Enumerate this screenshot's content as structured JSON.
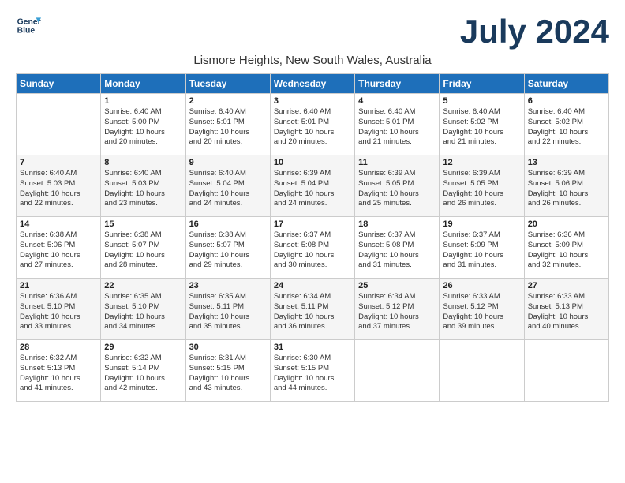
{
  "logo": {
    "line1": "General",
    "line2": "Blue"
  },
  "title": "July 2024",
  "subtitle": "Lismore Heights, New South Wales, Australia",
  "days_of_week": [
    "Sunday",
    "Monday",
    "Tuesday",
    "Wednesday",
    "Thursday",
    "Friday",
    "Saturday"
  ],
  "weeks": [
    [
      {
        "day": "",
        "info": ""
      },
      {
        "day": "1",
        "info": "Sunrise: 6:40 AM\nSunset: 5:00 PM\nDaylight: 10 hours\nand 20 minutes."
      },
      {
        "day": "2",
        "info": "Sunrise: 6:40 AM\nSunset: 5:01 PM\nDaylight: 10 hours\nand 20 minutes."
      },
      {
        "day": "3",
        "info": "Sunrise: 6:40 AM\nSunset: 5:01 PM\nDaylight: 10 hours\nand 20 minutes."
      },
      {
        "day": "4",
        "info": "Sunrise: 6:40 AM\nSunset: 5:01 PM\nDaylight: 10 hours\nand 21 minutes."
      },
      {
        "day": "5",
        "info": "Sunrise: 6:40 AM\nSunset: 5:02 PM\nDaylight: 10 hours\nand 21 minutes."
      },
      {
        "day": "6",
        "info": "Sunrise: 6:40 AM\nSunset: 5:02 PM\nDaylight: 10 hours\nand 22 minutes."
      }
    ],
    [
      {
        "day": "7",
        "info": "Sunrise: 6:40 AM\nSunset: 5:03 PM\nDaylight: 10 hours\nand 22 minutes."
      },
      {
        "day": "8",
        "info": "Sunrise: 6:40 AM\nSunset: 5:03 PM\nDaylight: 10 hours\nand 23 minutes."
      },
      {
        "day": "9",
        "info": "Sunrise: 6:40 AM\nSunset: 5:04 PM\nDaylight: 10 hours\nand 24 minutes."
      },
      {
        "day": "10",
        "info": "Sunrise: 6:39 AM\nSunset: 5:04 PM\nDaylight: 10 hours\nand 24 minutes."
      },
      {
        "day": "11",
        "info": "Sunrise: 6:39 AM\nSunset: 5:05 PM\nDaylight: 10 hours\nand 25 minutes."
      },
      {
        "day": "12",
        "info": "Sunrise: 6:39 AM\nSunset: 5:05 PM\nDaylight: 10 hours\nand 26 minutes."
      },
      {
        "day": "13",
        "info": "Sunrise: 6:39 AM\nSunset: 5:06 PM\nDaylight: 10 hours\nand 26 minutes."
      }
    ],
    [
      {
        "day": "14",
        "info": "Sunrise: 6:38 AM\nSunset: 5:06 PM\nDaylight: 10 hours\nand 27 minutes."
      },
      {
        "day": "15",
        "info": "Sunrise: 6:38 AM\nSunset: 5:07 PM\nDaylight: 10 hours\nand 28 minutes."
      },
      {
        "day": "16",
        "info": "Sunrise: 6:38 AM\nSunset: 5:07 PM\nDaylight: 10 hours\nand 29 minutes."
      },
      {
        "day": "17",
        "info": "Sunrise: 6:37 AM\nSunset: 5:08 PM\nDaylight: 10 hours\nand 30 minutes."
      },
      {
        "day": "18",
        "info": "Sunrise: 6:37 AM\nSunset: 5:08 PM\nDaylight: 10 hours\nand 31 minutes."
      },
      {
        "day": "19",
        "info": "Sunrise: 6:37 AM\nSunset: 5:09 PM\nDaylight: 10 hours\nand 31 minutes."
      },
      {
        "day": "20",
        "info": "Sunrise: 6:36 AM\nSunset: 5:09 PM\nDaylight: 10 hours\nand 32 minutes."
      }
    ],
    [
      {
        "day": "21",
        "info": "Sunrise: 6:36 AM\nSunset: 5:10 PM\nDaylight: 10 hours\nand 33 minutes."
      },
      {
        "day": "22",
        "info": "Sunrise: 6:35 AM\nSunset: 5:10 PM\nDaylight: 10 hours\nand 34 minutes."
      },
      {
        "day": "23",
        "info": "Sunrise: 6:35 AM\nSunset: 5:11 PM\nDaylight: 10 hours\nand 35 minutes."
      },
      {
        "day": "24",
        "info": "Sunrise: 6:34 AM\nSunset: 5:11 PM\nDaylight: 10 hours\nand 36 minutes."
      },
      {
        "day": "25",
        "info": "Sunrise: 6:34 AM\nSunset: 5:12 PM\nDaylight: 10 hours\nand 37 minutes."
      },
      {
        "day": "26",
        "info": "Sunrise: 6:33 AM\nSunset: 5:12 PM\nDaylight: 10 hours\nand 39 minutes."
      },
      {
        "day": "27",
        "info": "Sunrise: 6:33 AM\nSunset: 5:13 PM\nDaylight: 10 hours\nand 40 minutes."
      }
    ],
    [
      {
        "day": "28",
        "info": "Sunrise: 6:32 AM\nSunset: 5:13 PM\nDaylight: 10 hours\nand 41 minutes."
      },
      {
        "day": "29",
        "info": "Sunrise: 6:32 AM\nSunset: 5:14 PM\nDaylight: 10 hours\nand 42 minutes."
      },
      {
        "day": "30",
        "info": "Sunrise: 6:31 AM\nSunset: 5:15 PM\nDaylight: 10 hours\nand 43 minutes."
      },
      {
        "day": "31",
        "info": "Sunrise: 6:30 AM\nSunset: 5:15 PM\nDaylight: 10 hours\nand 44 minutes."
      },
      {
        "day": "",
        "info": ""
      },
      {
        "day": "",
        "info": ""
      },
      {
        "day": "",
        "info": ""
      }
    ]
  ]
}
